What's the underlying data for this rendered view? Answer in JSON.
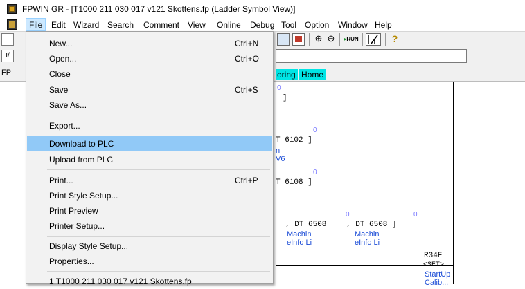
{
  "window": {
    "title": "FPWIN GR - [T1000 211 030 017 v121 Skottens.fp (Ladder Symbol View)]"
  },
  "menubar": {
    "items": [
      "File",
      "Edit",
      "Wizard",
      "Search",
      "Comment",
      "View",
      "Online",
      "Debug",
      "Tool",
      "Option",
      "Window",
      "Help"
    ]
  },
  "toolbar": {
    "run_label": "RUN",
    "left_button_2": "I/"
  },
  "tabs": {
    "left": "FP",
    "monitoring_partial": "oring",
    "home": "Home"
  },
  "file_menu": {
    "items": [
      {
        "label": "New...",
        "shortcut": "Ctrl+N"
      },
      {
        "label": "Open...",
        "shortcut": "Ctrl+O"
      },
      {
        "label": "Close",
        "shortcut": ""
      },
      {
        "label": "Save",
        "shortcut": "Ctrl+S"
      },
      {
        "label": "Save As...",
        "shortcut": ""
      },
      {
        "label": "Export...",
        "shortcut": ""
      },
      {
        "label": "Download to PLC",
        "shortcut": "",
        "highlighted": true
      },
      {
        "label": "Upload from PLC",
        "shortcut": ""
      },
      {
        "label": "Print...",
        "shortcut": "Ctrl+P"
      },
      {
        "label": "Print Style Setup...",
        "shortcut": ""
      },
      {
        "label": "Print Preview",
        "shortcut": ""
      },
      {
        "label": "Printer Setup...",
        "shortcut": ""
      },
      {
        "label": "Display Style Setup...",
        "shortcut": ""
      },
      {
        "label": "Properties...",
        "shortcut": ""
      },
      {
        "label": "1 T1000 211 030 017 v121 Skottens.fp",
        "shortcut": ""
      }
    ]
  },
  "ladder": {
    "line1_index": "0",
    "line1_text": "]",
    "line2_index": "0",
    "line2_text": "T 6102   ]",
    "line2_comment_a": "n",
    "line2_comment_b": "V6",
    "line3_index": "0",
    "line3_text": "T 6108   ]",
    "line4_index_a": "0",
    "line4_index_b": "0",
    "line4_text_a": ",   DT 6508",
    "line4_text_b": ",   DT 6508   ]",
    "line4_comment_a1": "Machin",
    "line4_comment_a2": "eInfo Li",
    "line4_comment_b1": "Machin",
    "line4_comment_b2": "eInfo Li",
    "coil_address": "R34F",
    "coil_instr": "<SET>",
    "coil_comment_1": "StartUp",
    "coil_comment_2": "Calib..."
  },
  "colors": {
    "highlight": "#91c9f7",
    "menu_bg": "#f2f2f2",
    "tab_cyan": "#00e5e5",
    "comment_blue": "#1a4bd6"
  }
}
